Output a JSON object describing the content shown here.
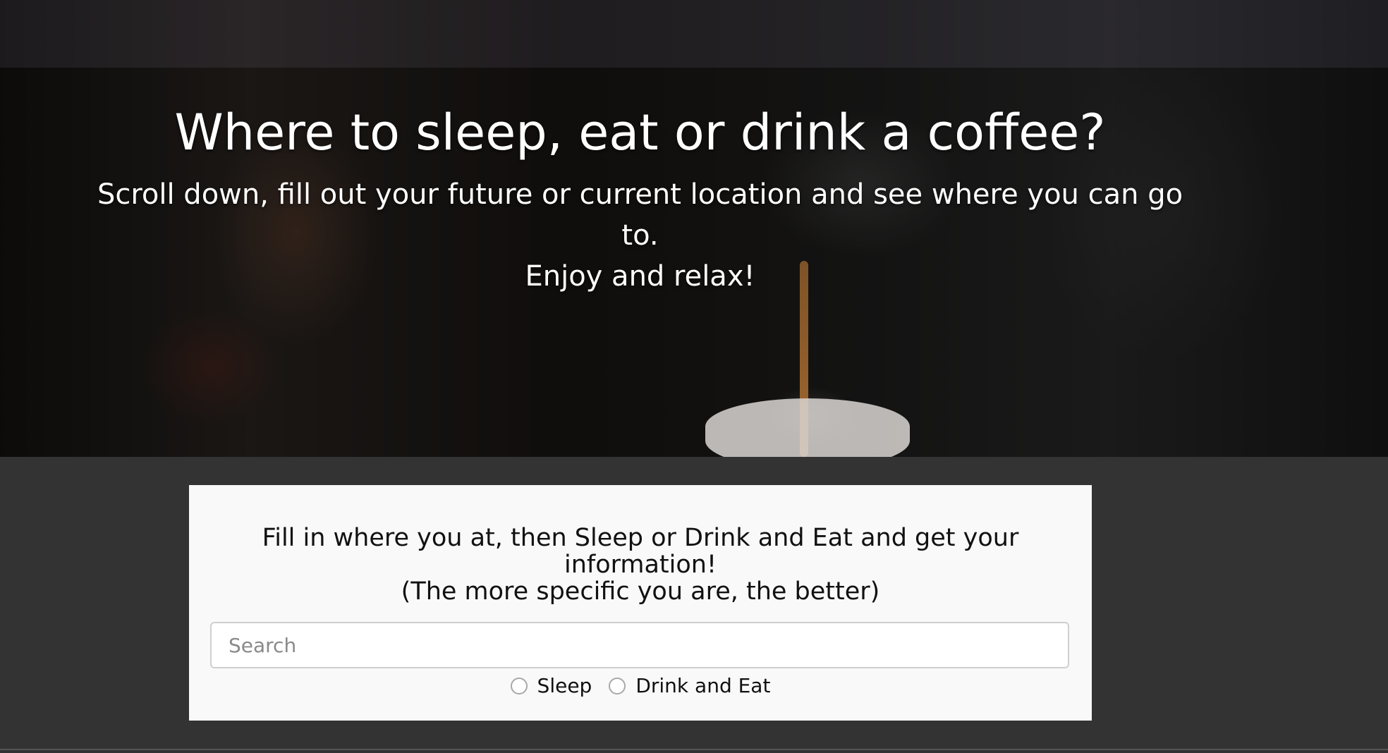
{
  "hero": {
    "title": "Where to sleep, eat or drink a coffee?",
    "subtitle_line1": "Scroll down, fill out your future or current location and see where you can go to.",
    "subtitle_line2": "Enjoy and relax!",
    "background_image": "espresso-machine-photo"
  },
  "panel": {
    "instruction_line1": "Fill in where you at, then Sleep or Drink and Eat and get your information!",
    "instruction_line2": "(The more specific you are, the better)",
    "search_placeholder": "Search",
    "search_value": "",
    "options": [
      {
        "label": "Sleep",
        "selected": false
      },
      {
        "label": "Drink and Eat",
        "selected": false
      }
    ]
  },
  "colors": {
    "page_background": "#333333",
    "panel_background": "#f9f9f9",
    "hero_text": "#ffffff"
  }
}
